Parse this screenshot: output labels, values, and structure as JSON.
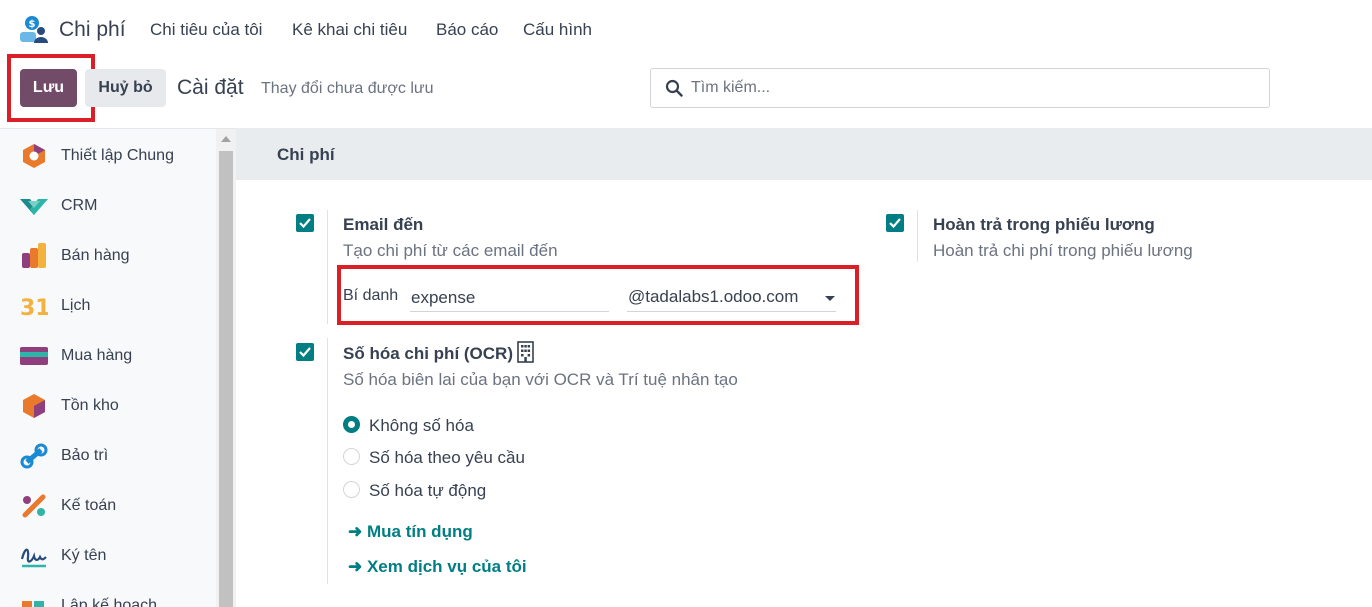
{
  "app": {
    "name": "Chi phí",
    "menu": [
      "Chi tiêu của tôi",
      "Kê khai chi tiêu",
      "Báo cáo",
      "Cấu hình"
    ]
  },
  "control_panel": {
    "save_label": "Lưu",
    "discard_label": "Huỷ bỏ",
    "title": "Cài đặt",
    "status": "Thay đổi chưa được lưu",
    "search_placeholder": "Tìm kiếm..."
  },
  "sidebar": {
    "items": [
      {
        "label": "Thiết lập Chung",
        "icon": "general-settings-icon"
      },
      {
        "label": "CRM",
        "icon": "crm-icon"
      },
      {
        "label": "Bán hàng",
        "icon": "sales-icon"
      },
      {
        "label": "Lịch",
        "icon": "calendar-icon",
        "icon_text": "31"
      },
      {
        "label": "Mua hàng",
        "icon": "purchase-icon"
      },
      {
        "label": "Tồn kho",
        "icon": "inventory-icon"
      },
      {
        "label": "Bảo trì",
        "icon": "maintenance-icon"
      },
      {
        "label": "Kế toán",
        "icon": "accounting-icon"
      },
      {
        "label": "Ký tên",
        "icon": "sign-icon"
      },
      {
        "label": "Lập kế hoạch",
        "icon": "planning-icon"
      }
    ]
  },
  "section": {
    "title": "Chi phí"
  },
  "settings": {
    "email": {
      "title": "Email đến",
      "desc": "Tạo chi phí từ các email đến",
      "checked": true,
      "alias_label": "Bí danh",
      "alias_value": "expense",
      "domain": "@tadalabs1.odoo.com"
    },
    "payslip": {
      "title": "Hoàn trả trong phiếu lương",
      "desc": "Hoàn trả chi phí trong phiếu lương",
      "checked": true
    },
    "ocr": {
      "title": "Số hóa chi phí (OCR)",
      "desc": "Số hóa biên lai của bạn với OCR và Trí tuệ nhân tạo",
      "checked": true,
      "options": [
        "Không số hóa",
        "Số hóa theo yêu cầu",
        "Số hóa tự động"
      ],
      "selected": "Không số hóa",
      "links": [
        "➜ Mua tín dụng",
        "➜ Xem dịch vụ của tôi"
      ]
    }
  },
  "colors": {
    "primary": "#714B67",
    "accent": "#017e84",
    "highlight": "#dc1f26"
  }
}
